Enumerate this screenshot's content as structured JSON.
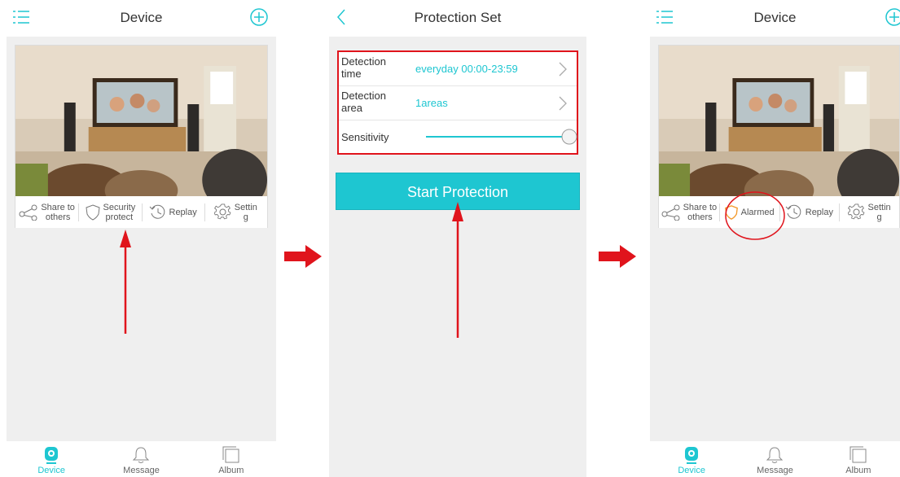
{
  "screen1": {
    "title": "Device",
    "actions": [
      {
        "label": "Share to\nothers",
        "icon": "share-icon"
      },
      {
        "label": "Security\nprotect",
        "icon": "shield-icon"
      },
      {
        "label": "Replay",
        "icon": "replay-icon"
      },
      {
        "label": "Settin\ng",
        "icon": "settings-icon"
      }
    ],
    "tabs": [
      {
        "label": "Device",
        "icon": "camera-icon",
        "active": true
      },
      {
        "label": "Message",
        "icon": "bell-icon",
        "active": false
      },
      {
        "label": "Album",
        "icon": "album-icon",
        "active": false
      }
    ]
  },
  "screen2": {
    "title": "Protection Set",
    "rows": [
      {
        "label": "Detection\ntime",
        "value": "everyday 00:00-23:59"
      },
      {
        "label": "Detection\narea",
        "value": "1areas"
      },
      {
        "label": "Sensitivity",
        "value": ""
      }
    ],
    "sensitivity_level": 1.0,
    "start_button": "Start Protection"
  },
  "screen3": {
    "title": "Device",
    "actions": [
      {
        "label": "Share to\nothers",
        "icon": "share-icon"
      },
      {
        "label": "Alarmed",
        "icon": "shield-icon"
      },
      {
        "label": "Replay",
        "icon": "replay-icon"
      },
      {
        "label": "Settin\ng",
        "icon": "settings-icon"
      }
    ],
    "tabs": [
      {
        "label": "Device",
        "icon": "camera-icon",
        "active": true
      },
      {
        "label": "Message",
        "icon": "bell-icon",
        "active": false
      },
      {
        "label": "Album",
        "icon": "album-icon",
        "active": false
      }
    ]
  },
  "colors": {
    "accent": "#1ec6d1",
    "annotation_red": "#e0141c",
    "alarm_orange": "#f39a2b"
  }
}
